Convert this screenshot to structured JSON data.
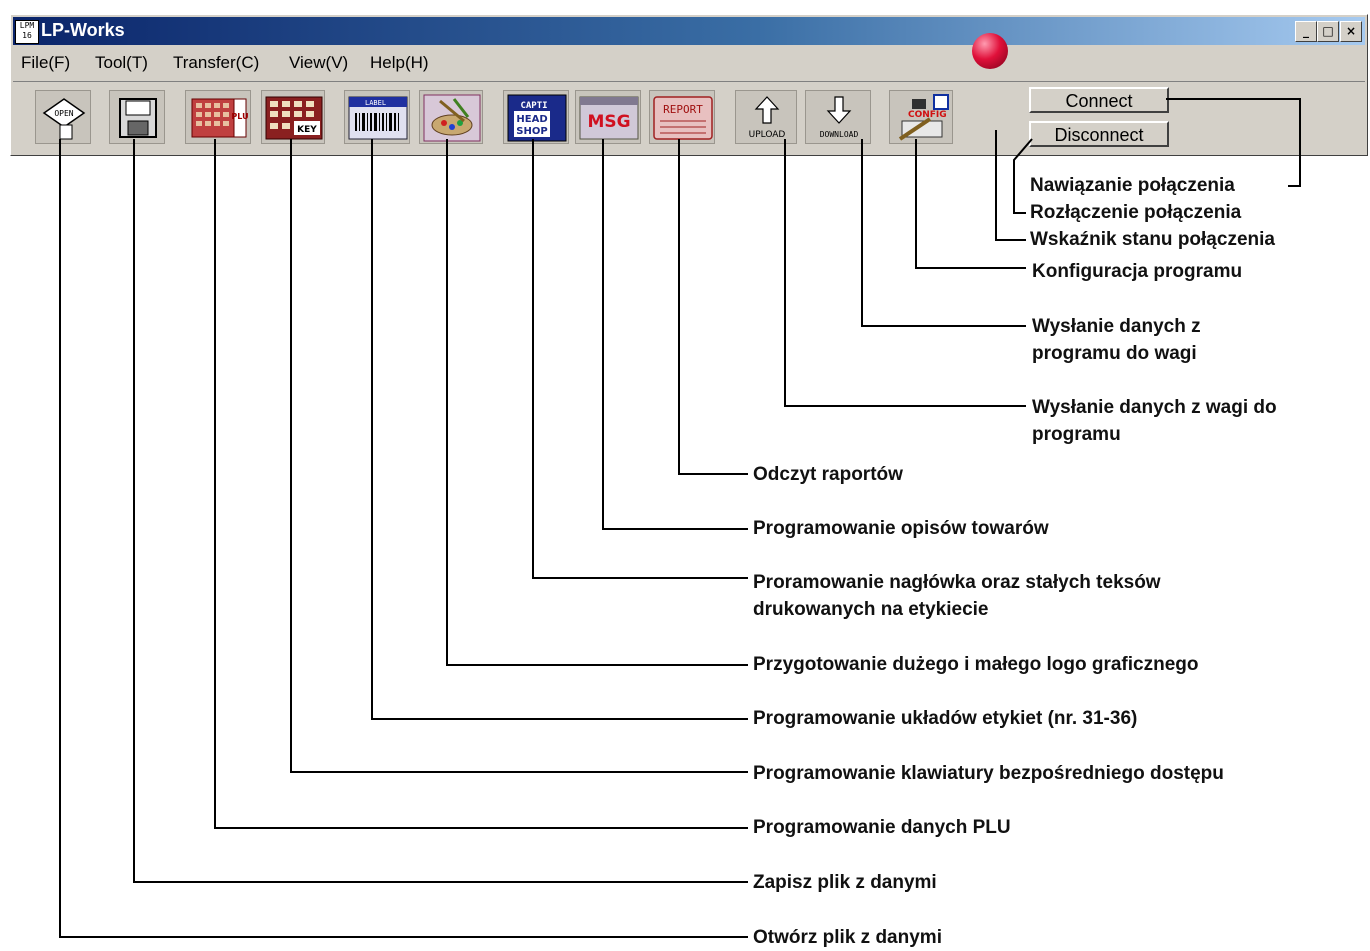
{
  "window": {
    "app_icon_text": "LPM 16",
    "title": "LP-Works",
    "minimize_glyph": "_",
    "maximize_glyph": "□",
    "close_glyph": "×"
  },
  "menu": [
    "File(F)",
    "Tool(T)",
    "Transfer(C)",
    "View(V)",
    "Help(H)"
  ],
  "toolbar": {
    "open_text": "OPEN",
    "plu_text": "PLU",
    "key_text": "KEY",
    "label_text": "LABEL",
    "caption_text": "CAPTI",
    "head_text": "HEAD",
    "shop_text": "SHOP",
    "msg_text": "MSG",
    "report_text": "REPORT",
    "upload_text": "UPLOAD",
    "download_text": "DOWNLOAD",
    "config_text": "CONFIG",
    "connect_label": "Connect",
    "disconnect_label": "Disconnect",
    "led_color": "#e0103a"
  },
  "callouts": {
    "connect": "Nawiązanie połączenia",
    "disconnect": "Rozłączenie połączenia",
    "status": "Wskaźnik stanu połączenia",
    "config": "Konfiguracja programu",
    "download_1": "Wysłanie danych z",
    "download_2": "programu do wagi",
    "upload_1": "Wysłanie danych z wagi do",
    "upload_2": "programu",
    "report": "Odczyt raportów",
    "msg": "Programowanie opisów towarów",
    "header_1": "Proramowanie nagłówka oraz stałych teksów",
    "header_2": "drukowanych na etykiecie",
    "logo": "Przygotowanie dużego i małego logo graficznego",
    "label": "Programowanie układów etykiet (nr. 31-36)",
    "keyboard": "Programowanie klawiatury bezpośredniego dostępu",
    "plu": "Programowanie danych PLU",
    "save": "Zapisz plik z danymi",
    "open": "Otwórz plik z danymi"
  }
}
